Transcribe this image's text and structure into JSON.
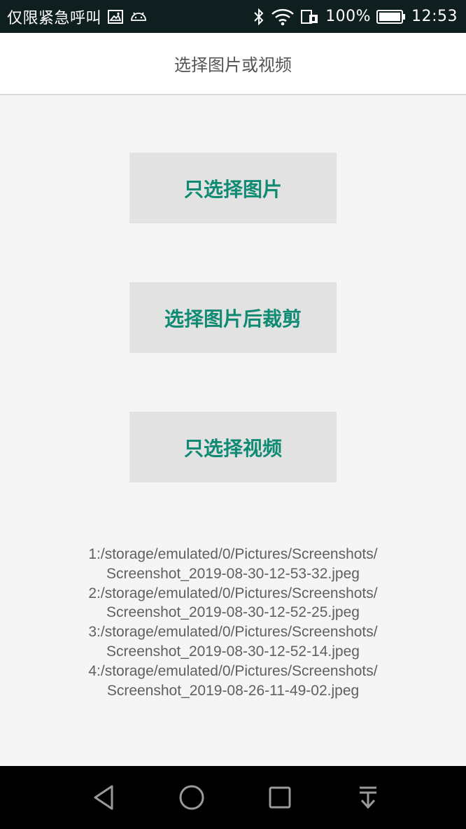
{
  "status_bar": {
    "carrier": "仅限紧急呼叫",
    "battery": "100%",
    "time": "12:53",
    "icons": [
      "image-icon",
      "android-icon",
      "bluetooth-icon",
      "wifi-icon",
      "sim-icon",
      "battery-icon"
    ]
  },
  "titlebar": {
    "title": "选择图片或视频"
  },
  "buttons": {
    "select_image": "只选择图片",
    "select_crop": "选择图片后裁剪",
    "select_video": "只选择视频"
  },
  "results": [
    "1:/storage/emulated/0/Pictures/Screenshots/",
    "Screenshot_2019-08-30-12-53-32.jpeg",
    "2:/storage/emulated/0/Pictures/Screenshots/",
    "Screenshot_2019-08-30-12-52-25.jpeg",
    "3:/storage/emulated/0/Pictures/Screenshots/",
    "Screenshot_2019-08-30-12-52-14.jpeg",
    "4:/storage/emulated/0/Pictures/Screenshots/",
    "Screenshot_2019-08-26-11-49-02.jpeg"
  ],
  "colors": {
    "accent": "#0f8a73",
    "status_bar_bg": "#0f1f1f",
    "button_bg": "#e2e2e2",
    "page_bg": "#f5f5f5"
  },
  "navbar": {
    "icons": [
      "back-icon",
      "home-icon",
      "recents-icon",
      "notification-pull-icon"
    ]
  }
}
